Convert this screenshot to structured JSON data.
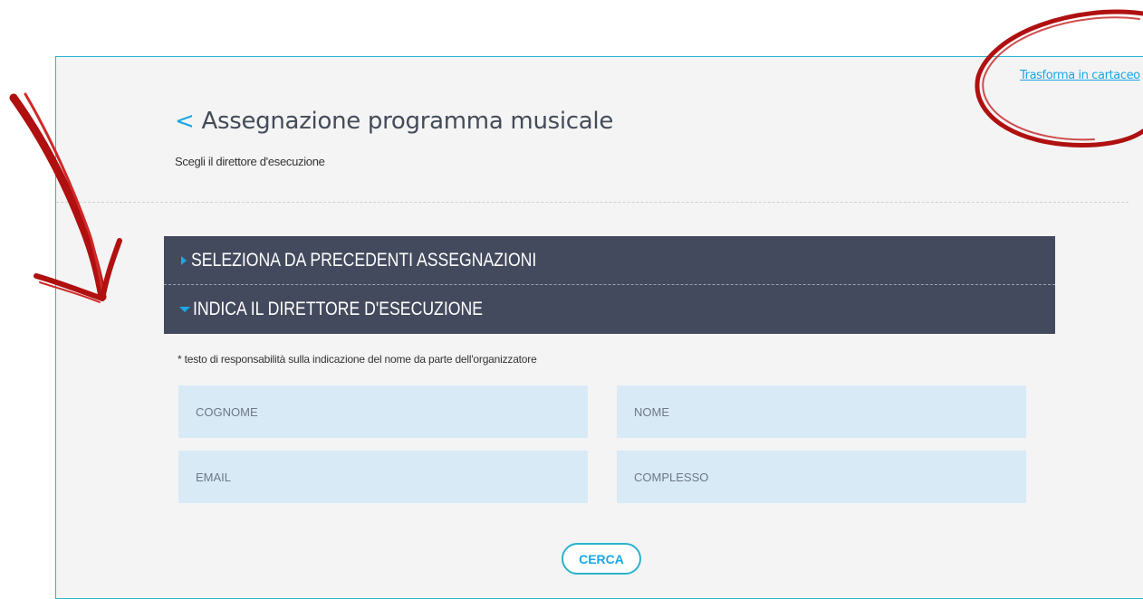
{
  "header": {
    "convert_link": "Trasforma in cartaceo",
    "back_symbol": "<",
    "title": "Assegnazione programma musicale",
    "subtitle": "Scegli il direttore d'esecuzione"
  },
  "accordion": [
    {
      "label": "SELEZIONA DA PRECEDENTI ASSEGNAZIONI",
      "expanded": false
    },
    {
      "label": "INDICA IL DIRETTORE D'ESECUZIONE",
      "expanded": true
    }
  ],
  "form": {
    "note": "* testo di responsabilità sulla indicazione del nome da parte dell'organizzatore",
    "fields": {
      "cognome": {
        "placeholder": "COGNOME",
        "value": ""
      },
      "nome": {
        "placeholder": "NOME",
        "value": ""
      },
      "email": {
        "placeholder": "EMAIL",
        "value": ""
      },
      "complesso": {
        "placeholder": "COMPLESSO",
        "value": ""
      }
    },
    "search_label": "CERCA"
  },
  "colors": {
    "accent": "#1aa7e6",
    "accordion_bg": "#434a5d",
    "field_bg": "#d9eaf7",
    "annotation_red": "#b01010"
  }
}
